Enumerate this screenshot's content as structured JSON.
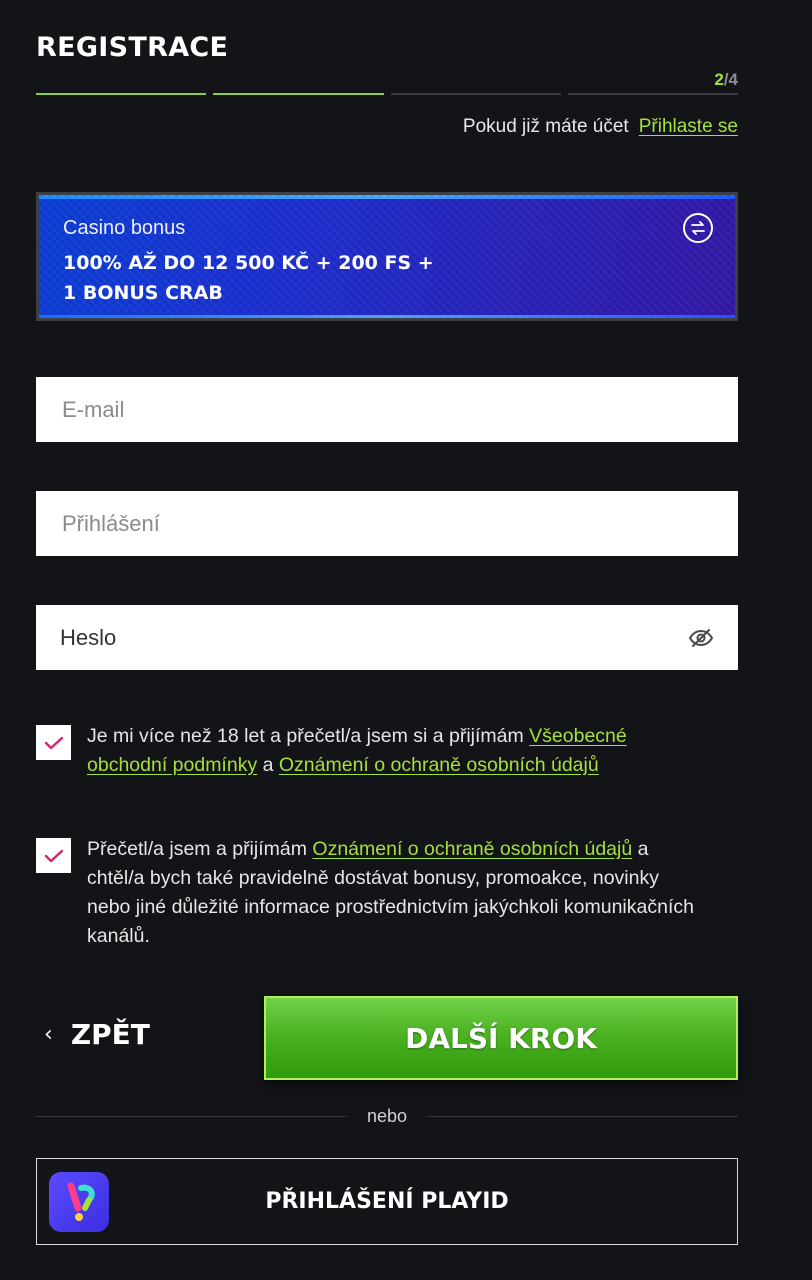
{
  "header": {
    "title": "REGISTRACE",
    "step_current": "2",
    "step_sep": "/",
    "step_total": "4"
  },
  "progress": {
    "completed_steps": 2,
    "total_steps": 4
  },
  "login_prompt": {
    "question": "Pokud již máte účet",
    "link": "Přihlaste se"
  },
  "bonus": {
    "label": "Casino bonus",
    "offer_line1": "100% AŽ DO 12 500 KČ + 200 FS +",
    "offer_line2": "1 BONUS CRAB",
    "switch_icon": "swap-arrows-icon"
  },
  "form": {
    "email_placeholder": "E-mail",
    "login_placeholder": "Přihlášení",
    "password_value": "Heslo",
    "password_icon": "eye-hidden-icon"
  },
  "consents": {
    "terms": {
      "checked": true,
      "text_before": "Je mi více než 18 let a přečetl/a jsem si a přijímám ",
      "link_terms": "Všeobecné obchodní podmínky",
      "text_mid": " a ",
      "link_privacy": "Oznámení o ochraně osobních údajů"
    },
    "marketing": {
      "checked": true,
      "text_before": "Přečetl/a jsem a přijímám ",
      "link_privacy": "Oznámení o ochraně osobních údajů",
      "text_after": " a chtěl/a bych také pravidelně dostávat bonusy, promoakce, novinky nebo jiné důležité informace prostřednictvím jakýchkoli komunikačních kanálů."
    }
  },
  "actions": {
    "back_chevron": "‹",
    "back_label": "ZPĚT",
    "next_label": "DALŠÍ KROK"
  },
  "divider": {
    "text": "nebo"
  },
  "playid": {
    "label": "PŘIHLÁŠENÍ PLAYID",
    "logo_icon": "playid-logo-icon"
  },
  "colors": {
    "background": "#121418",
    "accent_green": "#a6e03c",
    "button_green": "#4cb322",
    "bonus_blue": "#1c2fd0",
    "checkmark": "#d6246e"
  }
}
